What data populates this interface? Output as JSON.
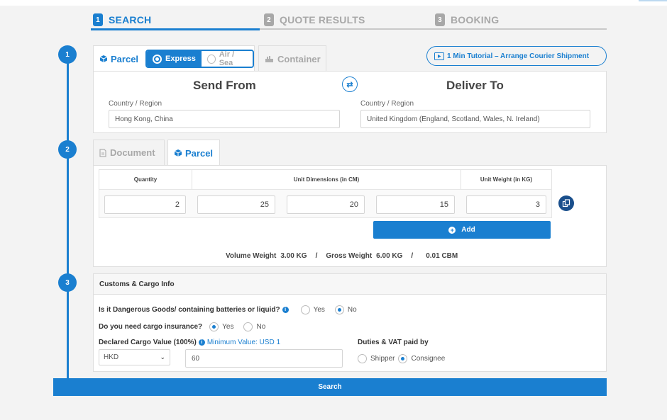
{
  "steps": [
    {
      "num": "1",
      "label": "SEARCH"
    },
    {
      "num": "2",
      "label": "QUOTE RESULTS"
    },
    {
      "num": "3",
      "label": "BOOKING"
    }
  ],
  "timeline": [
    "1",
    "2",
    "3"
  ],
  "mode_tabs": {
    "parcel": "Parcel",
    "express": "Express",
    "air_sea": "Air / Sea",
    "container": "Container"
  },
  "tutorial": "1 Min Tutorial – Arrange Courier Shipment",
  "route": {
    "send_from_title": "Send From",
    "deliver_to_title": "Deliver To",
    "from_label": "Country / Region",
    "from_value": "Hong Kong, China",
    "to_label": "Country / Region",
    "to_value": "United Kingdom (England, Scotland, Wales, N. Ireland)"
  },
  "package_tabs": {
    "document": "Document",
    "parcel": "Parcel"
  },
  "table": {
    "headers": {
      "quantity": "Quantity",
      "dimensions": "Unit Dimensions (in CM)",
      "weight": "Unit Weight (in KG)"
    },
    "row": {
      "quantity": "2",
      "length": "25",
      "width": "20",
      "height": "15",
      "weight": "3"
    },
    "add_label": "Add"
  },
  "summary": {
    "volume_label": "Volume Weight",
    "volume_value": "3.00 KG",
    "sep1": "/",
    "gross_label": "Gross Weight",
    "gross_value": "6.00 KG",
    "sep2": "/",
    "cbm": "0.01 CBM"
  },
  "customs": {
    "title": "Customs & Cargo Info",
    "dangerous_q": "Is it Dangerous Goods/ containing batteries or liquid?",
    "dangerous_yes": "Yes",
    "dangerous_no": "No",
    "insurance_q": "Do you need cargo insurance?",
    "insurance_yes": "Yes",
    "insurance_no": "No",
    "declared_label": "Declared Cargo Value (100%)",
    "minimum_note": "Minimum Value: USD 1",
    "currency": "HKD",
    "declared_value": "60",
    "duties_label": "Duties & VAT paid by",
    "shipper": "Shipper",
    "consignee": "Consignee"
  },
  "search_label": "Search",
  "colors": {
    "accent": "#1a7fd0",
    "dark_accent": "#1a4f8c",
    "inactive": "#a8a8a8"
  }
}
